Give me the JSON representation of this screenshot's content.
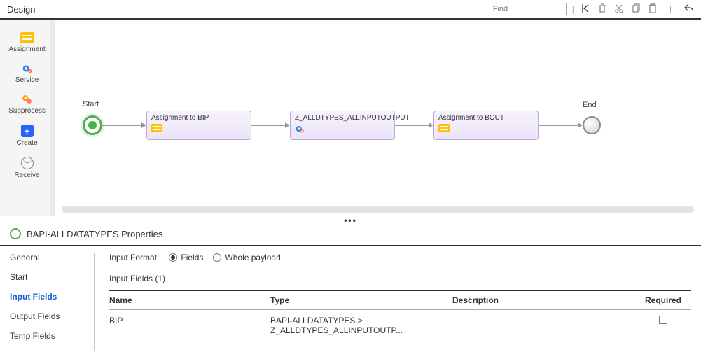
{
  "header": {
    "title": "Design",
    "find_placeholder": "Find"
  },
  "palette": {
    "items": [
      {
        "label": "Assignment"
      },
      {
        "label": "Service"
      },
      {
        "label": "Subprocess"
      },
      {
        "label": "Create"
      },
      {
        "label": "Receive"
      }
    ]
  },
  "flow": {
    "start_label": "Start",
    "end_label": "End",
    "tasks": [
      {
        "title": "Assignment to BIP"
      },
      {
        "title": "Z_ALLDTYPES_ALLINPUTOUTPUT"
      },
      {
        "title": "Assignment to BOUT"
      }
    ]
  },
  "properties": {
    "title": "BAPI-ALLDATATYPES Properties",
    "tabs": {
      "general": "General",
      "start": "Start",
      "input_fields": "Input Fields",
      "output_fields": "Output Fields",
      "temp_fields": "Temp Fields"
    },
    "input_format_label": "Input Format:",
    "radio_fields": "Fields",
    "radio_whole": "Whole payload",
    "grid_title": "Input Fields (1)",
    "columns": {
      "name": "Name",
      "type": "Type",
      "description": "Description",
      "required": "Required"
    },
    "rows": [
      {
        "name": "BIP",
        "type": "BAPI-ALLDATATYPES > Z_ALLDTYPES_ALLINPUTOUTP...",
        "description": "",
        "required": false
      }
    ]
  }
}
